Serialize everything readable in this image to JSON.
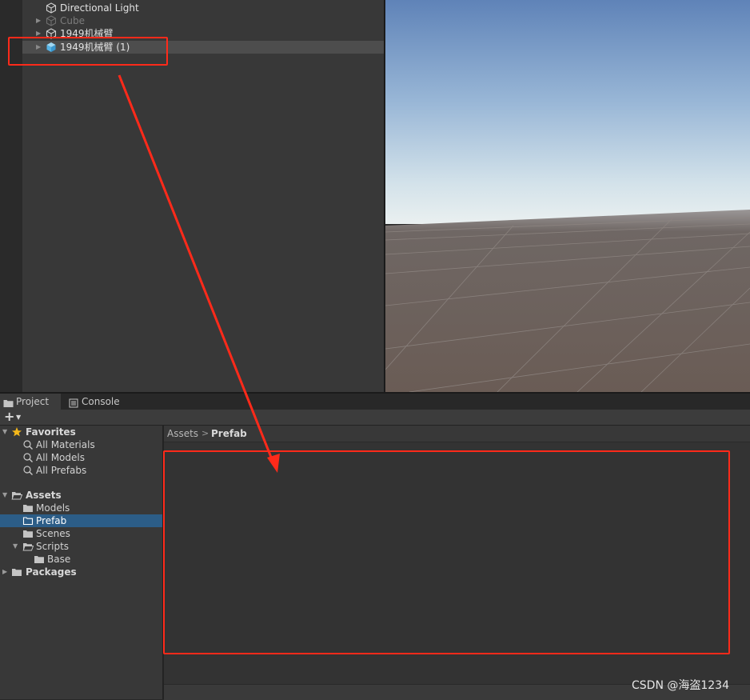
{
  "hierarchy": {
    "items": [
      {
        "label": "Directional Light",
        "state": "normal",
        "icon": "cube-outline-icon"
      },
      {
        "label": "Cube",
        "state": "inactive",
        "icon": "cube-outline-icon"
      },
      {
        "label": "1949机械臂",
        "state": "normal",
        "icon": "cube-outline-icon"
      },
      {
        "label": "1949机械臂 (1)",
        "state": "selected",
        "icon": "prefab-cube-icon"
      }
    ]
  },
  "tabs": [
    {
      "label": "Project",
      "icon": "folder-icon",
      "active": true
    },
    {
      "label": "Console",
      "icon": "console-icon",
      "active": false
    }
  ],
  "toolbar": {
    "add_icon": "plus-icon",
    "dropdown_icon": "caret-down-icon"
  },
  "project_tree": {
    "favorites": {
      "label": "Favorites",
      "icon": "star-icon",
      "items": [
        "All Materials",
        "All Models",
        "All Prefabs"
      ]
    },
    "assets": {
      "label": "Assets",
      "children": [
        {
          "label": "Models"
        },
        {
          "label": "Prefab",
          "selected": true
        },
        {
          "label": "Scenes"
        },
        {
          "label": "Scripts",
          "expanded": true,
          "children": [
            {
              "label": "Base"
            }
          ]
        }
      ]
    },
    "packages": {
      "label": "Packages"
    }
  },
  "breadcrumb": {
    "root": "Assets",
    "separator": ">",
    "current": "Prefab"
  },
  "watermark": "CSDN @海盗1234",
  "colors": {
    "annotation": "#ff2a1a",
    "selection": "#2c5d87",
    "panel_bg": "#383838",
    "sky_top": "#5f83b8",
    "horizon": "#e2eaec",
    "ground": "#6b605b"
  }
}
